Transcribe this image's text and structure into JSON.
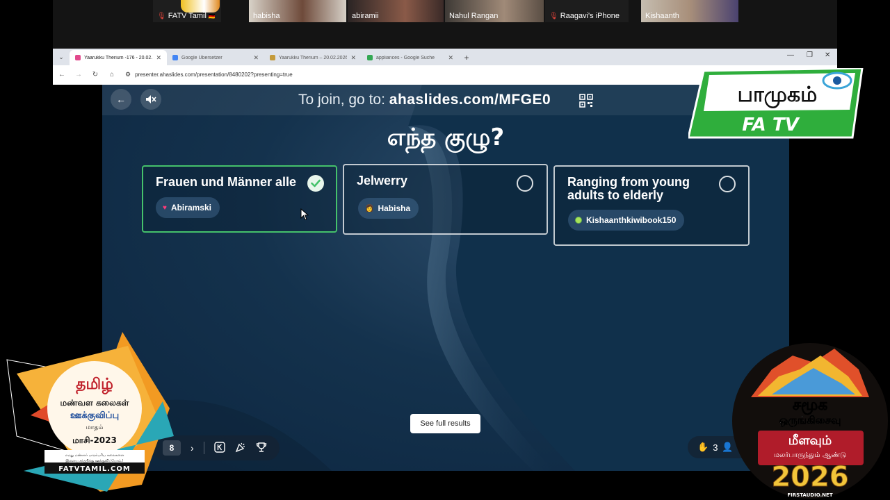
{
  "meeting": {
    "participants": [
      {
        "name": "FATV Tamil",
        "muted": true,
        "flag": "🇩🇪"
      },
      {
        "name": "habisha",
        "muted": false
      },
      {
        "name": "abiramii",
        "muted": false
      },
      {
        "name": "Nahul Rangan",
        "muted": false,
        "active": true
      },
      {
        "name": "Raagavi's iPhone",
        "muted": true
      },
      {
        "name": "Kishaanth",
        "muted": false
      }
    ]
  },
  "browser": {
    "tabs": [
      {
        "title": "Yaarukku Therium -176 - 20.02.",
        "active": true,
        "favicon_color": "#e24a8d"
      },
      {
        "title": "Google Übersetzer",
        "active": false,
        "favicon_color": "#4285f4"
      },
      {
        "title": "Yaarukku Therium – 20.02.2026",
        "active": false,
        "favicon_color": "#c49a3a"
      },
      {
        "title": "appliances - Google Suche",
        "active": false,
        "favicon_color": "#34a853"
      }
    ],
    "url": "presenter.ahaslides.com/presentation/8480202?presenting=true"
  },
  "presentation": {
    "join_prefix": "To join, go to:",
    "join_code": "ahaslides.com/MFGE0",
    "question": "எந்த குழு?",
    "options": [
      {
        "title": "Frauen und Männer alle",
        "correct": true,
        "responder": "Abiramski",
        "responder_icon": "♥"
      },
      {
        "title": "Jelwerry",
        "correct": false,
        "responder": "Habisha",
        "responder_icon": "👩"
      },
      {
        "title": "Ranging from young adults to elderly",
        "correct": false,
        "responder": "Kishaanthkiwibook150",
        "responder_icon": "dot"
      }
    ],
    "see_results_label": "See full results",
    "slide_number": "8",
    "hand_count": "3"
  },
  "overlays": {
    "logo_top": "பாமுகம்",
    "logo_bottom": "FA TV",
    "left_badge": {
      "line1": "தமிழ்",
      "line2": "மண்வள கலைகள்",
      "line3": "ஊக்குவிப்பு",
      "line4": "மாதம்",
      "line5": "மாசி-2023",
      "line6": "எமது மண்சார் பாரம்பரிய கலைகளை",
      "line7": "இளைய சந்ததிக்கு ஊக்குவிப்போம்.!",
      "site": "FATVTAMIL.COM"
    },
    "right_badge": {
      "line1": "சமூக",
      "line2": "ஒருங்கிசைவு",
      "line3": "மீளவும்",
      "line4": "மலர்பாருந்தும் ஆண்டு",
      "year": "2026",
      "site": "FIRSTAUDIO.NET"
    }
  },
  "colors": {
    "correct_green": "#45c26b",
    "presentation_bg": "#14324d",
    "logo_green": "#2fae3c"
  }
}
